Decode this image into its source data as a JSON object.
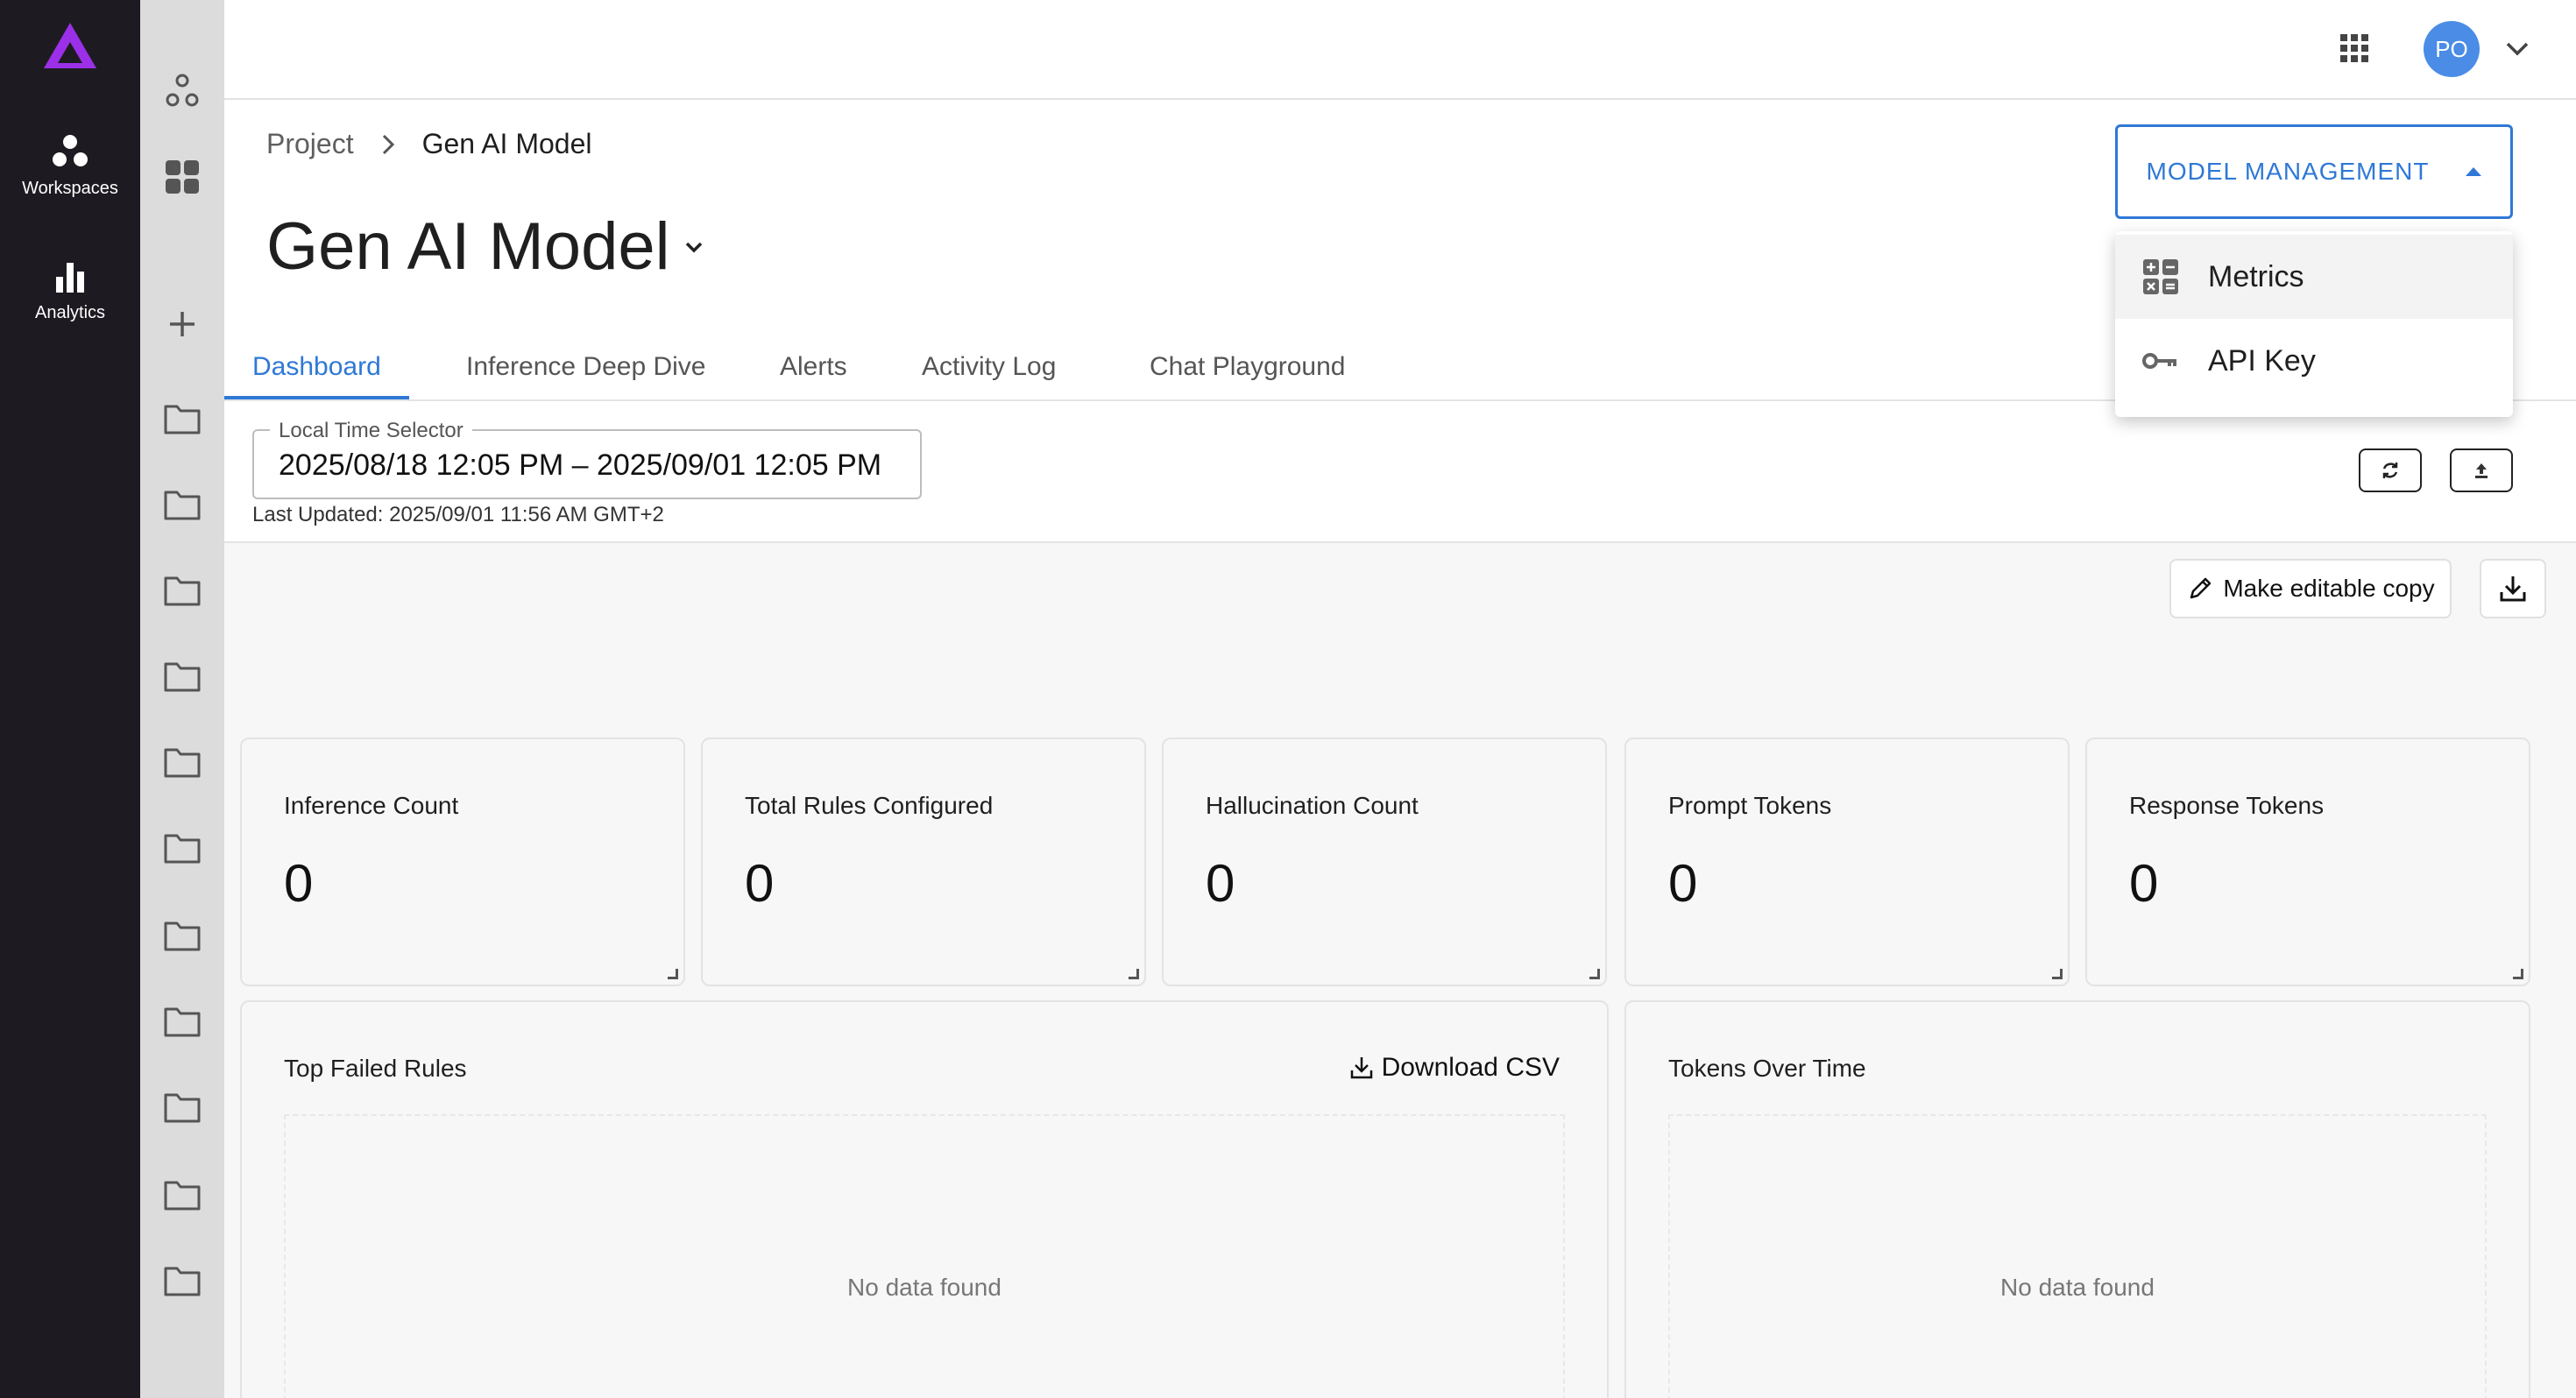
{
  "nav": {
    "items": [
      {
        "label": "Workspaces",
        "icon": "workspaces-icon"
      },
      {
        "label": "Analytics",
        "icon": "analytics-icon"
      }
    ]
  },
  "header": {
    "avatar_initials": "PO"
  },
  "breadcrumb": {
    "parent": "Project",
    "current": "Gen AI Model"
  },
  "page": {
    "title": "Gen AI Model"
  },
  "tabs": [
    {
      "label": "Dashboard",
      "active": true
    },
    {
      "label": "Inference Deep Dive",
      "active": false
    },
    {
      "label": "Alerts",
      "active": false
    },
    {
      "label": "Activity Log",
      "active": false
    },
    {
      "label": "Chat Playground",
      "active": false
    }
  ],
  "time_selector": {
    "label": "Local Time Selector",
    "value": "2025/08/18 12:05 PM – 2025/09/01 12:05 PM",
    "last_updated": "Last Updated: 2025/09/01 11:56 AM GMT+2"
  },
  "toolbar": {
    "make_copy_label": "Make editable copy"
  },
  "model_management": {
    "button_label": "MODEL MANAGEMENT",
    "items": [
      {
        "label": "Metrics",
        "icon": "calculator-icon"
      },
      {
        "label": "API Key",
        "icon": "key-icon"
      }
    ]
  },
  "stats": [
    {
      "title": "Inference Count",
      "value": "0"
    },
    {
      "title": "Total Rules Configured",
      "value": "0"
    },
    {
      "title": "Hallucination Count",
      "value": "0"
    },
    {
      "title": "Prompt Tokens",
      "value": "0"
    },
    {
      "title": "Response Tokens",
      "value": "0"
    }
  ],
  "panels": {
    "top_failed_rules": {
      "title": "Top Failed Rules",
      "download_label": "Download CSV",
      "empty": "No data found"
    },
    "tokens_over_time": {
      "title": "Tokens Over Time",
      "empty": "No data found"
    }
  },
  "colors": {
    "accent": "#2f78d6",
    "nav_bg": "#1d1b21",
    "logo": "#9b30e8",
    "avatar": "#4a8ce6"
  }
}
